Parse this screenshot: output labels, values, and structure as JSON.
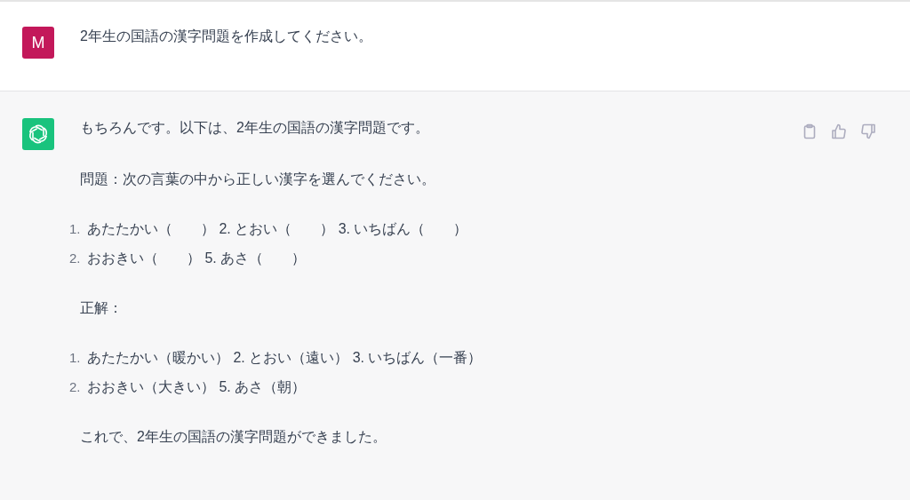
{
  "messages": [
    {
      "kind": "user",
      "avatar_letter": "M",
      "blocks": [
        {
          "kind": "paragraph",
          "text": "2年生の国語の漢字問題を作成してください。"
        }
      ]
    },
    {
      "kind": "assistant",
      "blocks": [
        {
          "kind": "paragraph",
          "text": "もちろんです。以下は、2年生の国語の漢字問題です。"
        },
        {
          "kind": "paragraph",
          "text": "問題：次の言葉の中から正しい漢字を選んでください。"
        },
        {
          "kind": "list",
          "items": [
            {
              "marker": "1.",
              "text": "あたたかい（　　） 2. とおい（　　） 3. いちばん（　　）"
            },
            {
              "marker": "2.",
              "text": "おおきい（　　） 5. あさ（　　）"
            }
          ]
        },
        {
          "kind": "paragraph",
          "text": "正解："
        },
        {
          "kind": "list",
          "items": [
            {
              "marker": "1.",
              "text": "あたたかい（暖かい） 2. とおい（遠い） 3. いちばん（一番）"
            },
            {
              "marker": "2.",
              "text": "おおきい（大きい） 5. あさ（朝）"
            }
          ]
        },
        {
          "kind": "paragraph",
          "text": "これで、2年生の国語の漢字問題ができました。"
        }
      ]
    }
  ]
}
